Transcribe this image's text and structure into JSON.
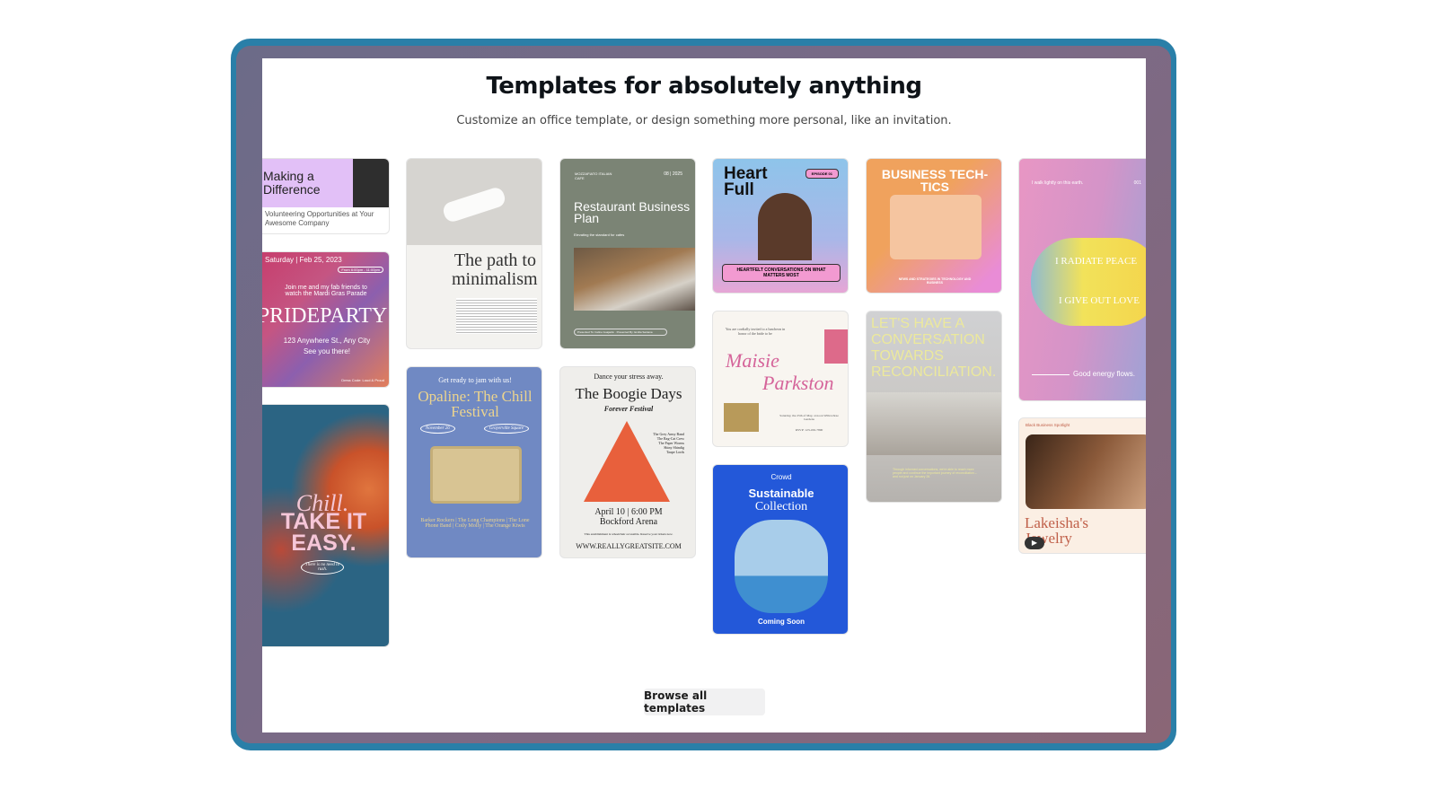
{
  "header": {
    "title": "Templates for absolutely anything",
    "subtitle": "Customize an office template, or design something more personal, like an invitation."
  },
  "cards": {
    "making": {
      "title": "Making a Difference",
      "caption": "Volunteering Opportunities at Your Awesome Company"
    },
    "pride": {
      "date": "Saturday | Feb 25, 2023",
      "time": "From 6:00pm - 11:00pm",
      "invite": "Join me and my fab friends to watch the Mardi Gras Parade",
      "title": "PRIDEPARTY",
      "address": "123 Anywhere St., Any City",
      "see": "See you there!",
      "dress": "Dress Code: Loud & Proud"
    },
    "chill": {
      "script": "Chill.",
      "title": "TAKE IT EASY.",
      "note": "There is no need to rush."
    },
    "path": {
      "title": "The path to minimalism"
    },
    "opaline": {
      "intro": "Get ready to jam with us!",
      "title": "Opaline: The Chill Festival",
      "date": "November 26",
      "place": "Grayerville Square",
      "bands": "Barker Rockers | The Long Champions | The Lone Phone Band | Coily Molly | The Orange Kiwis"
    },
    "restaurant": {
      "brand": "MOZZAFIATO ITALIAN CAFE",
      "date": "08 | 2025",
      "title": "Restaurant Business Plan",
      "tagline": "Elevating the standard for cafes",
      "footer": "Presented To: Celine Guajardo · Presented By: Emilia Santana"
    },
    "boogie": {
      "intro": "Dance your stress away.",
      "title": "The Boogie Days",
      "script": "Forever Festival",
      "lineup": "The Grey Army Band\nThe Rag-Cat Crew\nThe Paper Worms\nShiny Shindig\nTaupe Lords",
      "when": "April 10 | 6:00 PM",
      "where": "Bockford Arena",
      "note": "This establishment is wheelchair accessible. Reserve your tickets now.",
      "url": "WWW.REALLYGREATSITE.COM"
    },
    "heart": {
      "title": "Heart Full",
      "badge": "EPISODE 01",
      "tagline": "HEARTFELT CONVERSATIONS ON WHAT MATTERS MOST"
    },
    "maisie": {
      "invite": "You are cordially invited to a luncheon in honor of the bride to be",
      "first": "Maisie",
      "last": "Parkston",
      "details": "Saturday, the 25th of May, at noon Willowbrae Gardens",
      "rsvp": "RSVP: 123-456-7890"
    },
    "sustainable": {
      "brand": "Crowd",
      "title1": "Sustainable",
      "title2": "Collection",
      "footer": "Coming Soon"
    },
    "business": {
      "title": "BUSINESS TECH-TICS",
      "tagline": "NEWS AND STRATEGIES IN TECHNOLOGY AND BUSINESS"
    },
    "reconcile": {
      "title": "LET'S HAVE A CONVERSATION TOWARDS RECONCILIATION.",
      "body": "Through informed conversations, we're able to reach more people and continue the important journey of reconciliation – and not just on January 26."
    },
    "radiate": {
      "top": "I walk lightly on this earth.",
      "num": "001",
      "line1": "I RADIATE PEACE",
      "line2": "I GIVE OUT LOVE",
      "bottom": "Good energy flows."
    },
    "lakeisha": {
      "label": "Black Business Spotlight",
      "title": "Lakeisha's Jewelry"
    }
  },
  "browse_button": "Browse all templates"
}
